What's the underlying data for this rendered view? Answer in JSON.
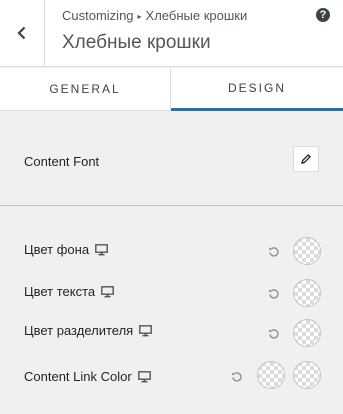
{
  "header": {
    "breadcrumb_root": "Customizing",
    "breadcrumb_separator": "▸",
    "breadcrumb_current": "Хлебные крошки",
    "title": "Хлебные крошки",
    "help_symbol": "?"
  },
  "tabs": [
    {
      "label": "GENERAL",
      "active": false
    },
    {
      "label": "DESIGN",
      "active": true
    }
  ],
  "font_setting": {
    "label": "Content Font",
    "icon": "pencil-icon"
  },
  "color_settings": [
    {
      "label": "Цвет фона",
      "device_icon": "desktop-icon",
      "swatches": 1
    },
    {
      "label": "Цвет текста",
      "device_icon": "desktop-icon",
      "swatches": 1
    },
    {
      "label": "Цвет разделителя",
      "device_icon": "desktop-icon",
      "swatches": 1
    },
    {
      "label": "Content Link Color",
      "device_icon": "desktop-icon",
      "swatches": 2
    }
  ],
  "colors": {
    "accent": "#2271b1",
    "background": "#f0f0f1",
    "panel": "#ffffff"
  }
}
